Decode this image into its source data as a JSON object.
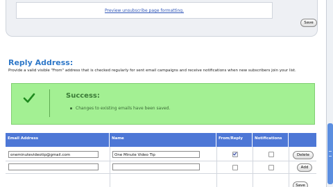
{
  "top_panel": {
    "preview_link": "Preview unsubscribe page formatting.",
    "save_label": "Save"
  },
  "reply_section": {
    "title": "Reply Address:",
    "description": "Provide a valid visible \"From\" address that is checked regularly for sent email campaigns and receive notifications when new subscribers join your list."
  },
  "success": {
    "title": "Success:",
    "message": "Changes to existing emails have been saved."
  },
  "table": {
    "headers": [
      "Email Address",
      "Name",
      "From/Reply",
      "Notifications"
    ],
    "rows": [
      {
        "email": "oneminutevideotip@gmail.com",
        "name": "One Minute Video Tip",
        "from_reply": true,
        "notifications": false,
        "button": "Delete"
      },
      {
        "email": "",
        "name": "",
        "from_reply": false,
        "notifications": false,
        "button": "Add"
      }
    ],
    "save_label": "Save"
  },
  "colors": {
    "header_bg": "#4d77d6",
    "title_blue": "#2f78c8",
    "success_bg": "#a3f093"
  }
}
